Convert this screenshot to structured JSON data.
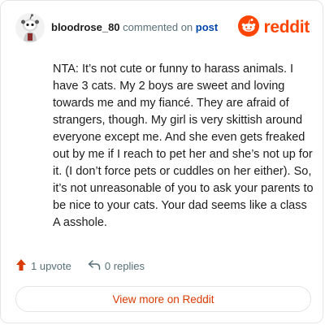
{
  "header": {
    "username": "bloodrose_80",
    "action_text": "commented on",
    "post_link": "post",
    "brand_word": "reddit",
    "avatar_icon": "snoo-avatar-icon",
    "brand_icon": "reddit-logo-icon"
  },
  "comment": {
    "text": "NTA: It’s not cute or funny to harass animals. I have 3 cats. My 2 boys are sweet and loving towards me and my fiancé. They are afraid of strangers, though. My girl is very skittish around everyone except me. And she even gets freaked out by me if I reach to pet her and she’s not up for it. (I don’t force pets or cuddles on her either). So, it’s not unreasonable of you to ask your parents to be nice to your cats. Your dad seems like a class A asshole."
  },
  "actions": {
    "upvote_label": "1 upvote",
    "replies_label": "0 replies",
    "upvote_icon": "upvote-arrow-icon",
    "reply_icon": "reply-arrow-icon"
  },
  "footer": {
    "view_label": "View more on Reddit"
  },
  "colors": {
    "brand": "#ff4500",
    "link": "#0045ac",
    "muted": "#576f76",
    "button_text": "#d93a00",
    "border": "#e3e6e8"
  }
}
